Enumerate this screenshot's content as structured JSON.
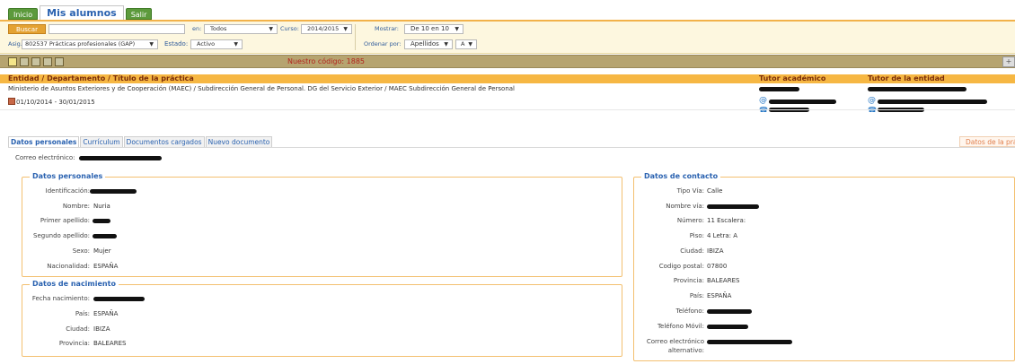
{
  "nav": {
    "inicio": "Inicio",
    "mis_alumnos": "Mis alumnos",
    "salir": "Salir"
  },
  "filters": {
    "buscar": "Buscar",
    "en_label": "en:",
    "en_value": "Todos",
    "curso_label": "Curso:",
    "curso_value": "2014/2015",
    "asig_label": "Asig.:",
    "asig_value": "802537 Prácticas profesionales (GAP)",
    "estado_label": "Estado:",
    "estado_value": "Activo",
    "mostrar_label": "Mostrar:",
    "mostrar_value": "De 10 en 10",
    "ordenar_label": "Ordenar por:",
    "ordenar_value": "Apellidos",
    "orden_dir": "A"
  },
  "toolbar": {
    "codigo": "Nuestro código: 1885",
    "plus": "+"
  },
  "table": {
    "headers": [
      "Entidad / Departamento / Título de la práctica",
      "Tutor académico",
      "Tutor de la entidad"
    ],
    "row": {
      "entidad": "Ministerio de Asuntos Exteriores y de Cooperación (MAEC) / Subdirección General de Personal. DG del Servicio Exterior / MAEC Subdirección General de Personal",
      "fechas": "01/10/2014 - 30/01/2015"
    }
  },
  "subtabs": [
    "Datos personales",
    "Currículum",
    "Documentos cargados",
    "Nuevo documento"
  ],
  "subtab_right": "Datos de la prác",
  "correo_label": "Correo electrónico:",
  "datos_personales": {
    "legend": "Datos personales",
    "fields": [
      {
        "label": "Identificación:",
        "value": ""
      },
      {
        "label": "Nombre:",
        "value": "Nuria"
      },
      {
        "label": "Primer apellido:",
        "value": ""
      },
      {
        "label": "Segundo apellido:",
        "value": ""
      },
      {
        "label": "Sexo:",
        "value": "Mujer"
      },
      {
        "label": "Nacionalidad:",
        "value": "ESPAÑA"
      }
    ]
  },
  "datos_nacimiento": {
    "legend": "Datos de nacimiento",
    "fields": [
      {
        "label": "Fecha nacimiento:",
        "value": ""
      },
      {
        "label": "País:",
        "value": "ESPAÑA"
      },
      {
        "label": "Ciudad:",
        "value": "IBIZA"
      },
      {
        "label": "Provincia:",
        "value": "BALEARES"
      }
    ]
  },
  "datos_contacto": {
    "legend": "Datos de contacto",
    "fields": [
      {
        "label": "Tipo Vía:",
        "value": "Calle"
      },
      {
        "label": "Nombre vía:",
        "value": ""
      },
      {
        "label": "Número:",
        "value": "11 Escalera:"
      },
      {
        "label": "Piso:",
        "value": "4 Letra: A"
      },
      {
        "label": "Ciudad:",
        "value": "IBIZA"
      },
      {
        "label": "Codigo postal:",
        "value": "07800"
      },
      {
        "label": "Provincia:",
        "value": "BALEARES"
      },
      {
        "label": "País:",
        "value": "ESPAÑA"
      },
      {
        "label": "Teléfono:",
        "value": ""
      },
      {
        "label": "Teléfono Móvil:",
        "value": ""
      },
      {
        "label": "Correo electrónico",
        "value": ""
      },
      {
        "label": "alternativo:",
        "value": ""
      }
    ]
  }
}
